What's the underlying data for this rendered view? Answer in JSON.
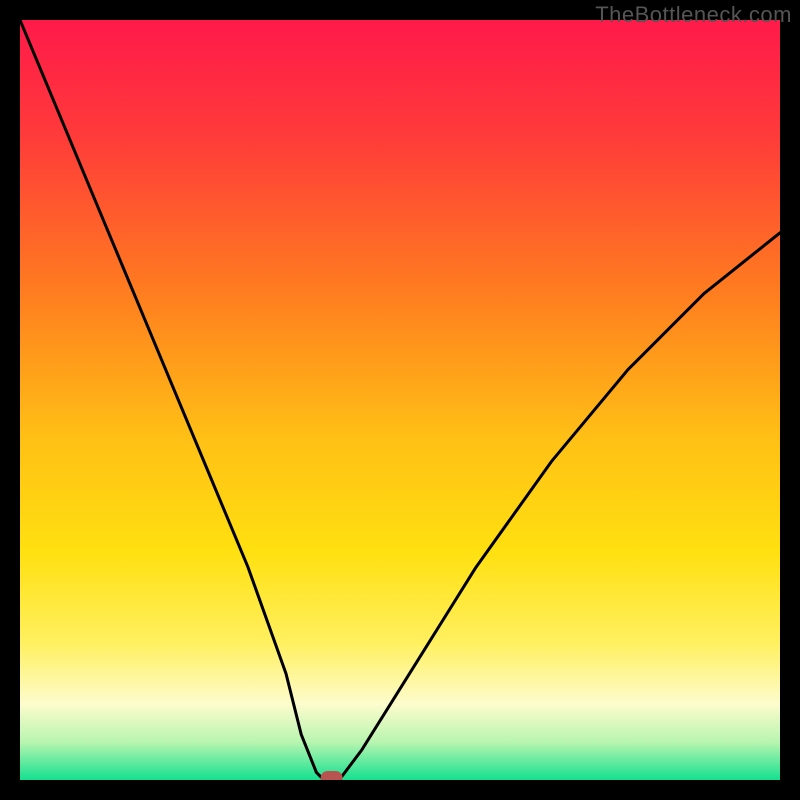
{
  "watermark": "TheBottleneck.com",
  "chart_data": {
    "type": "line",
    "title": "",
    "xlabel": "",
    "ylabel": "",
    "xlim": [
      0,
      100
    ],
    "ylim": [
      0,
      100
    ],
    "grid": false,
    "series": [
      {
        "name": "bottleneck-curve",
        "x": [
          0,
          5,
          10,
          15,
          20,
          25,
          30,
          35,
          37,
          39,
          40,
          41,
          42,
          45,
          50,
          55,
          60,
          65,
          70,
          75,
          80,
          85,
          90,
          95,
          100
        ],
        "y": [
          100,
          88,
          76,
          64,
          52,
          40,
          28,
          14,
          6,
          1,
          0,
          0,
          0,
          4,
          12,
          20,
          28,
          35,
          42,
          48,
          54,
          59,
          64,
          68,
          72
        ]
      }
    ],
    "marker": {
      "name": "optimal-point",
      "x": 41,
      "y": 0,
      "color": "#b85450"
    },
    "background_gradient": {
      "stops": [
        {
          "offset": 0.0,
          "color": "#ff1a4a"
        },
        {
          "offset": 0.15,
          "color": "#ff3a3a"
        },
        {
          "offset": 0.35,
          "color": "#ff7a20"
        },
        {
          "offset": 0.55,
          "color": "#ffc015"
        },
        {
          "offset": 0.7,
          "color": "#ffe010"
        },
        {
          "offset": 0.82,
          "color": "#fff060"
        },
        {
          "offset": 0.9,
          "color": "#fdfccc"
        },
        {
          "offset": 0.95,
          "color": "#b8f5b0"
        },
        {
          "offset": 1.0,
          "color": "#15e090"
        }
      ]
    }
  }
}
